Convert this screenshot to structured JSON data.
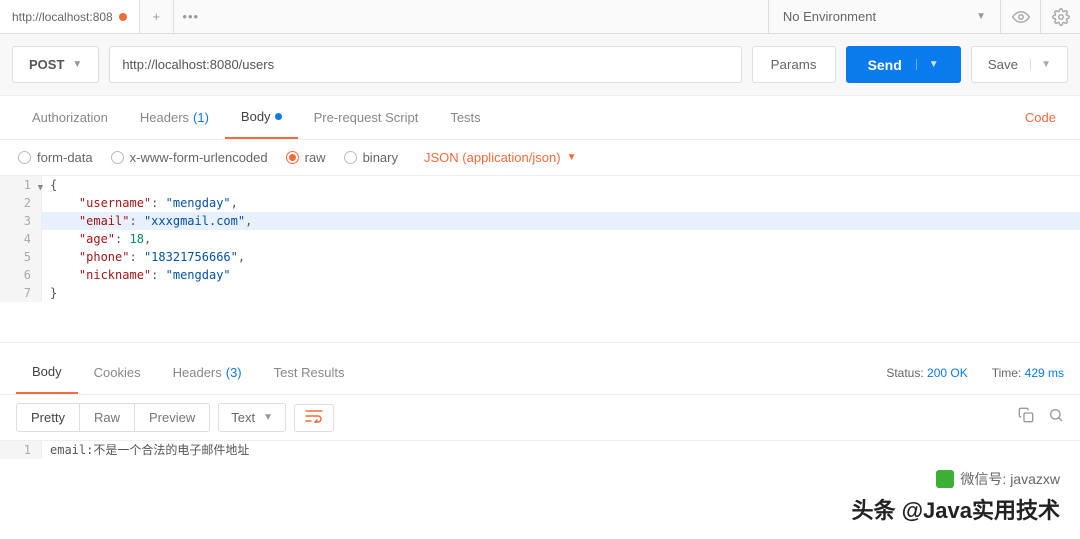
{
  "topBar": {
    "tab": {
      "title": "http://localhost:808"
    },
    "environment": {
      "label": "No Environment"
    }
  },
  "request": {
    "method": "POST",
    "url": "http://localhost:8080/users",
    "paramsLabel": "Params",
    "sendLabel": "Send",
    "saveLabel": "Save"
  },
  "reqTabs": {
    "authorization": "Authorization",
    "headers": "Headers",
    "headersCount": "(1)",
    "body": "Body",
    "preRequest": "Pre-request Script",
    "tests": "Tests",
    "codeLink": "Code"
  },
  "bodyOptions": {
    "formData": "form-data",
    "urlencoded": "x-www-form-urlencoded",
    "raw": "raw",
    "binary": "binary",
    "contentType": "JSON (application/json)"
  },
  "requestBody": {
    "username": "mengday",
    "email": "xxxgmail.com",
    "age": 18,
    "phone": "18321756666",
    "nickname": "mengday"
  },
  "respTabs": {
    "body": "Body",
    "cookies": "Cookies",
    "headers": "Headers",
    "headersCount": "(3)",
    "testResults": "Test Results",
    "statusLabel": "Status:",
    "statusValue": "200 OK",
    "timeLabel": "Time:",
    "timeValue": "429 ms"
  },
  "respToolbar": {
    "pretty": "Pretty",
    "raw": "Raw",
    "preview": "Preview",
    "format": "Text"
  },
  "responseBody": {
    "line1": "email:不是一个合法的电子邮件地址"
  },
  "watermark": {
    "line1": "微信号: javazxw",
    "line2": "头条 @Java实用技术"
  }
}
